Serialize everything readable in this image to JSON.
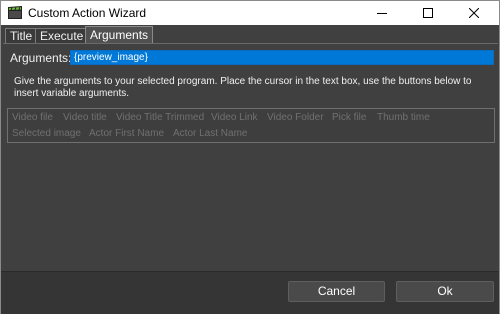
{
  "window": {
    "title": "Custom Action Wizard",
    "icon": "clapperboard-icon",
    "controls": [
      "minimize-icon",
      "maximize-icon",
      "close-icon"
    ]
  },
  "tabs": [
    {
      "label": "Title",
      "active": false
    },
    {
      "label": "Execute",
      "active": false
    },
    {
      "label": "Arguments",
      "active": true
    }
  ],
  "arguments": {
    "label": "Arguments:",
    "value": "{preview_image}"
  },
  "help_text": "Give the arguments to your selected program. Place the cursor in the text box, use the buttons below to insert variable arguments.",
  "variables": [
    "Video file",
    "Video title",
    "Video Title Trimmed",
    "Video Link",
    "Video Folder",
    "Pick file",
    "Thumb time",
    "Selected image",
    "Actor First Name",
    "Actor Last Name"
  ],
  "buttons": {
    "cancel": "Cancel",
    "ok": "Ok"
  },
  "colors": {
    "background": "#404040",
    "accent": "#0078d7",
    "disabled_text": "#707070",
    "footer": "#353535"
  }
}
